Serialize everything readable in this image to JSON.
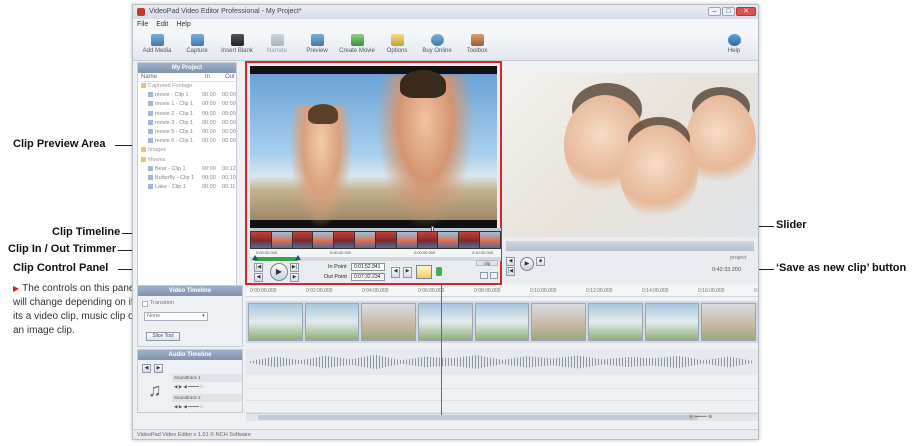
{
  "window": {
    "title": "VideoPad Video Editor Professional - My Project*",
    "buttons": {
      "minimize": "–",
      "maximize": "□",
      "close": "✕"
    }
  },
  "menu": [
    "File",
    "Edit",
    "Help"
  ],
  "toolbar": {
    "items": [
      {
        "label": "Add Media",
        "icon": "add-media-icon"
      },
      {
        "label": "Capture",
        "icon": "capture-icon"
      },
      {
        "label": "Insert Blank",
        "icon": "insert-blank-icon"
      },
      {
        "label": "Narrate",
        "icon": "narrate-icon"
      },
      {
        "label": "Preview",
        "icon": "preview-icon"
      },
      {
        "label": "Create Movie",
        "icon": "create-movie-icon"
      },
      {
        "label": "Options",
        "icon": "options-icon"
      },
      {
        "label": "Buy Online",
        "icon": "buy-online-icon"
      },
      {
        "label": "Toolbox",
        "icon": "toolbox-icon"
      }
    ],
    "help_label": "Help"
  },
  "project_panel": {
    "title": "My Project",
    "columns": [
      "Name",
      "In",
      "Out"
    ],
    "rows": [
      {
        "type": "folder",
        "name": "Captured Footage",
        "in": "",
        "out": ""
      },
      {
        "type": "clip",
        "name": "movie - Clip 1",
        "in": "00:00",
        "out": "00:00"
      },
      {
        "type": "clip",
        "name": "movie 1 - Clip 1",
        "in": "00:00",
        "out": "00:00"
      },
      {
        "type": "clip",
        "name": "movie 2 - Clip 1",
        "in": "00:00",
        "out": "00:00"
      },
      {
        "type": "clip",
        "name": "movie 3 - Clip 1",
        "in": "00:00",
        "out": "00:00"
      },
      {
        "type": "clip",
        "name": "movie 5 - Clip 1",
        "in": "00:00",
        "out": "00:00"
      },
      {
        "type": "clip",
        "name": "movie 6 - Clip 1",
        "in": "00:00",
        "out": "00:00"
      },
      {
        "type": "folder",
        "name": "Images",
        "in": "",
        "out": ""
      },
      {
        "type": "folder",
        "name": "Movies",
        "in": "",
        "out": ""
      },
      {
        "type": "clip",
        "name": "Bear - Clip 1",
        "in": "00:00",
        "out": "00:12"
      },
      {
        "type": "clip",
        "name": "Butterfly - Clip 1",
        "in": "00:00",
        "out": "00:10"
      },
      {
        "type": "clip",
        "name": "Lake - Clip 1",
        "in": "00:00",
        "out": "00:11"
      }
    ]
  },
  "clip_panel": {
    "ruler": [
      "0:00:00.000",
      "0:00:00.000",
      "0:00:00.000",
      "0:40:00.000"
    ],
    "in_point_label": "In Point",
    "in_point_value": "0:01:52.841",
    "out_point_label": "Out Point",
    "out_point_value": "0:07:32.234",
    "tab_label": "clip",
    "slider_position": 0.73
  },
  "project_preview": {
    "tab_label": "project",
    "time_value": "0:42:33.200"
  },
  "timeline": {
    "ruler": [
      "0:00:00.000",
      "0:02:00.000",
      "0:04:00.000",
      "0:06:00.000",
      "0:08:00.000",
      "0:10:00.000",
      "0:12:00.000",
      "0:14:00.000",
      "0:16:00.000",
      "0:18:00.000"
    ],
    "clip_count": 9
  },
  "video_timeline": {
    "title": "Video Timeline",
    "transition_label": "Transition",
    "transition_value": "None",
    "slice_button": "Slice Tool"
  },
  "audio_timeline": {
    "title": "Audio Timeline",
    "tracks": [
      "Soundtrack 1",
      "Soundtrack 2"
    ]
  },
  "status_bar": "VideoPad Video Editor v 1.01 © NCH Software",
  "callouts": {
    "clip_preview_area": "Clip Preview Area",
    "clip_timeline": "Clip Timeline",
    "clip_in_out_trimmer": "Clip In / Out Trimmer",
    "clip_control_panel": "Clip Control Panel",
    "slider": "Slider",
    "save_as_new_clip": "‘Save as new clip’ button",
    "note": "The controls on this panel will change depending on if its a video clip, music clip or an image clip."
  },
  "colors": {
    "highlight_border": "#d9262c",
    "panel_header": "#8fa2bb",
    "playhead": "#e03a3a"
  }
}
